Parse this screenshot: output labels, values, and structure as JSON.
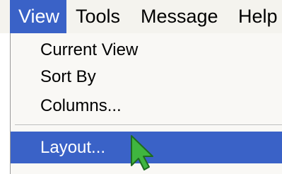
{
  "menubar": {
    "items": [
      {
        "label": "View",
        "active": true
      },
      {
        "label": "Tools",
        "active": false
      },
      {
        "label": "Message",
        "active": false
      },
      {
        "label": "Help",
        "active": false
      }
    ]
  },
  "dropdown": {
    "items": [
      {
        "label": "Current View"
      },
      {
        "label": "Sort By"
      },
      {
        "label": "Columns..."
      },
      {
        "label": "Layout...",
        "highlighted": true
      }
    ]
  },
  "cursor": {
    "icon": "arrow-pointer-icon",
    "color": "#3fb53f"
  },
  "colors": {
    "highlight": "#3a62c7",
    "menu_background": "#f9f8f5",
    "menubar_background": "#f4f3ee"
  }
}
